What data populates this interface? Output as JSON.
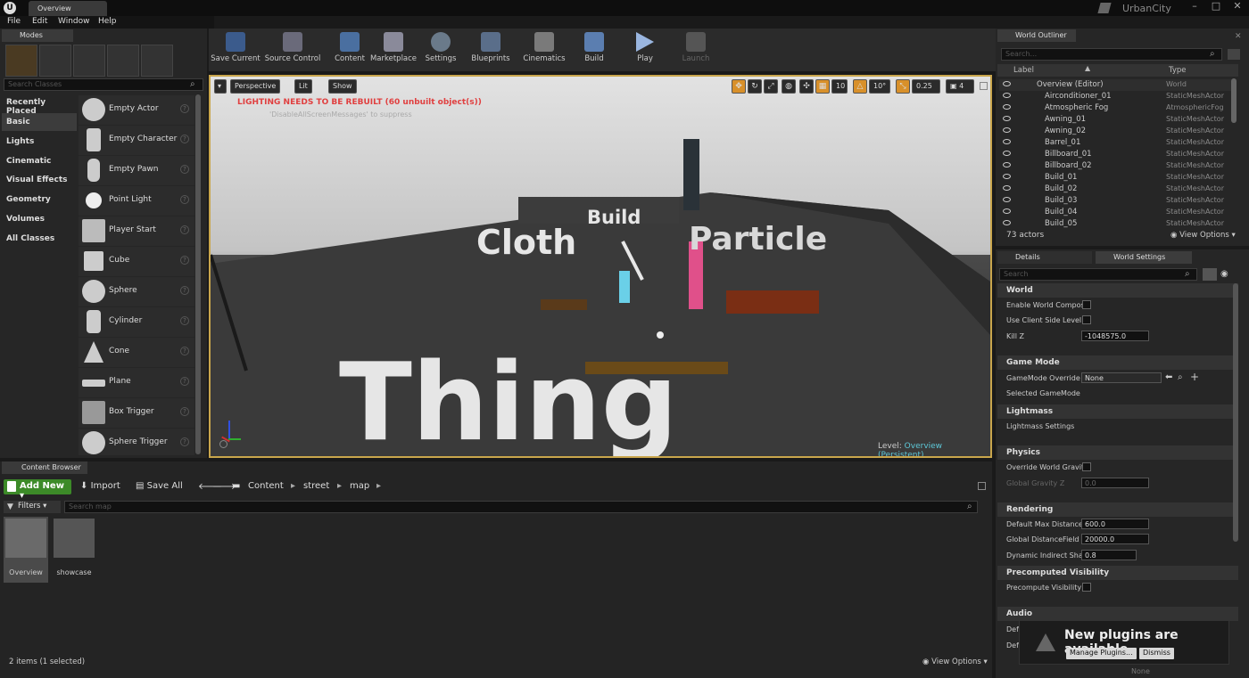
{
  "window": {
    "doc_tab": "Overview",
    "project": "UrbanCity",
    "logo": "U"
  },
  "menu": [
    "File",
    "Edit",
    "Window",
    "Help"
  ],
  "modes": {
    "tab": "Modes",
    "search_placeholder": "Search Classes",
    "categories": [
      "Recently Placed",
      "Basic",
      "Lights",
      "Cinematic",
      "Visual Effects",
      "Geometry",
      "Volumes",
      "All Classes"
    ],
    "items": [
      "Empty Actor",
      "Empty Character",
      "Empty Pawn",
      "Point Light",
      "Player Start",
      "Cube",
      "Sphere",
      "Cylinder",
      "Cone",
      "Plane",
      "Box Trigger",
      "Sphere Trigger"
    ]
  },
  "toolbar": [
    "Save Current",
    "Source Control",
    "Content",
    "Marketplace",
    "Settings",
    "Blueprints",
    "Cinematics",
    "Build",
    "Play",
    "Launch"
  ],
  "viewport": {
    "perspective": "Perspective",
    "lit": "Lit",
    "show": "Show",
    "warning": "LIGHTING NEEDS TO BE REBUILT (60 unbuilt object(s))",
    "hint": "'DisableAllScreenMessages' to suppress",
    "grid_snap": "10",
    "rot_snap": "10°",
    "scale_snap": "0.25",
    "camera_speed": "4",
    "text_cloth": "Cloth",
    "text_build": "Build",
    "text_particle": "Particle",
    "text_thing": "Thing",
    "level_label": "Level:",
    "level_value": "Overview (Persistent)"
  },
  "outliner": {
    "tab": "World Outliner",
    "search_placeholder": "Search...",
    "col_label": "Label",
    "col_type": "Type",
    "rows": [
      {
        "name": "Overview (Editor)",
        "type": "World"
      },
      {
        "name": "Airconditioner_01",
        "type": "StaticMeshActor"
      },
      {
        "name": "Atmospheric Fog",
        "type": "AtmosphericFog"
      },
      {
        "name": "Awning_01",
        "type": "StaticMeshActor"
      },
      {
        "name": "Awning_02",
        "type": "StaticMeshActor"
      },
      {
        "name": "Barrel_01",
        "type": "StaticMeshActor"
      },
      {
        "name": "Billboard_01",
        "type": "StaticMeshActor"
      },
      {
        "name": "Billboard_02",
        "type": "StaticMeshActor"
      },
      {
        "name": "Build_01",
        "type": "StaticMeshActor"
      },
      {
        "name": "Build_02",
        "type": "StaticMeshActor"
      },
      {
        "name": "Build_03",
        "type": "StaticMeshActor"
      },
      {
        "name": "Build_04",
        "type": "StaticMeshActor"
      },
      {
        "name": "Build_05",
        "type": "StaticMeshActor"
      }
    ],
    "count": "73 actors",
    "view_options": "View Options"
  },
  "details": {
    "tab": "Details",
    "ws_tab": "World Settings",
    "search_placeholder": "Search",
    "sec_world": "World",
    "enable_world_comp": "Enable World Composi",
    "use_client_side": "Use Client Side Level",
    "kill_z": "Kill Z",
    "kill_z_val": "-1048575.0",
    "sec_game_mode": "Game Mode",
    "gamemode_override": "GameMode Override",
    "gamemode_val": "None",
    "selected_gamemode": "Selected GameMode",
    "sec_lightmass": "Lightmass",
    "lightmass_settings": "Lightmass Settings",
    "sec_physics": "Physics",
    "override_gravity": "Override World Gravity",
    "global_gravity": "Global Gravity Z",
    "global_gravity_val": "0.0",
    "sec_rendering": "Rendering",
    "default_max_dist": "Default Max Distance",
    "default_max_dist_val": "600.0",
    "global_df": "Global DistanceField V",
    "global_df_val": "20000.0",
    "dyn_indirect": "Dynamic Indirect Shac",
    "dyn_indirect_val": "0.8",
    "sec_precomputed": "Precomputed Visibility",
    "precompute_vis": "Precompute Visibility",
    "sec_audio": "Audio",
    "audio_1": "Defa",
    "audio_2": "Defa",
    "audio_3": "None"
  },
  "content_browser": {
    "tab": "Content Browser",
    "add_new": "Add New",
    "import": "Import",
    "save_all": "Save All",
    "path": [
      "Content",
      "street",
      "map"
    ],
    "filters": "Filters",
    "search_placeholder": "Search map",
    "assets": [
      "Overview",
      "showcase"
    ],
    "status": "2 items (1 selected)",
    "view_options": "View Options"
  },
  "notification": {
    "title": "New plugins are available",
    "manage": "Manage Plugins...",
    "dismiss": "Dismiss"
  }
}
